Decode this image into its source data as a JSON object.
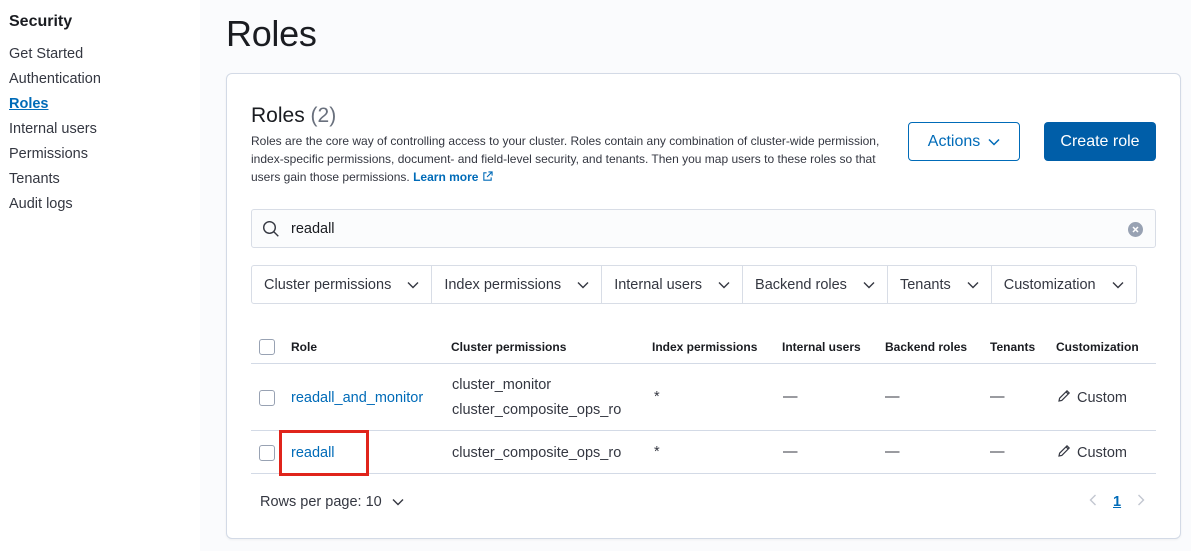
{
  "sidebar": {
    "title": "Security",
    "items": [
      {
        "label": "Get Started"
      },
      {
        "label": "Authentication"
      },
      {
        "label": "Roles"
      },
      {
        "label": "Internal users"
      },
      {
        "label": "Permissions"
      },
      {
        "label": "Tenants"
      },
      {
        "label": "Audit logs"
      }
    ],
    "active": "Roles"
  },
  "page": {
    "title": "Roles"
  },
  "panel": {
    "title": "Roles",
    "count": "(2)",
    "description": "Roles are the core way of controlling access to your cluster. Roles contain any combination of cluster-wide permission, index-specific permissions, document- and field-level security, and tenants. Then you map users to these roles so that users gain those permissions.",
    "learn_more": "Learn more",
    "actions_label": "Actions",
    "create_label": "Create role"
  },
  "search": {
    "value": "readall"
  },
  "filters": [
    {
      "label": "Cluster permissions"
    },
    {
      "label": "Index permissions"
    },
    {
      "label": "Internal users"
    },
    {
      "label": "Backend roles"
    },
    {
      "label": "Tenants"
    },
    {
      "label": "Customization"
    }
  ],
  "table": {
    "headers": {
      "role": "Role",
      "cluster": "Cluster permissions",
      "index": "Index permissions",
      "users": "Internal users",
      "backend": "Backend roles",
      "tenants": "Tenants",
      "custom": "Customization"
    },
    "rows": [
      {
        "role": "readall_and_monitor",
        "cluster_1": "cluster_monitor",
        "cluster_2": "cluster_composite_ops_ro",
        "index": "*",
        "users": "—",
        "backend": "—",
        "tenants": "—",
        "custom": "Custom"
      },
      {
        "role": "readall",
        "cluster_1": "cluster_composite_ops_ro",
        "index": "*",
        "users": "—",
        "backend": "—",
        "tenants": "—",
        "custom": "Custom"
      }
    ]
  },
  "footer": {
    "rows_per_page": "Rows per page: 10",
    "current_page": "1"
  },
  "colors": {
    "accent": "#006bb8",
    "primary_button": "#005ea8",
    "highlight": "#e0241b"
  }
}
